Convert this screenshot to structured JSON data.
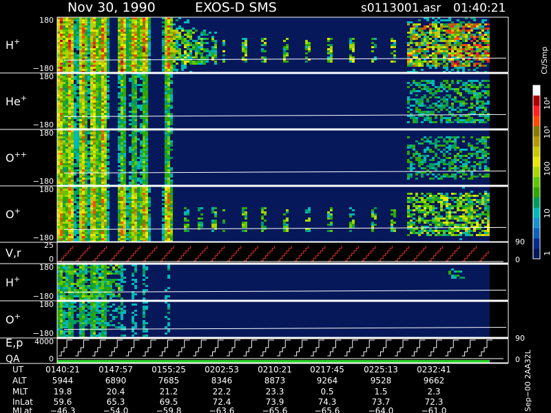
{
  "header": {
    "date": "Nov 30, 1990",
    "instrument": "EXOS-D SMS",
    "file": "s0113001.asr",
    "time": "01:40:21"
  },
  "colorbar": {
    "title": "Ct/Smp",
    "labels": [
      "10⁴",
      "10³",
      "100",
      "10",
      "1"
    ],
    "colors": [
      "#ffffff",
      "#b00000",
      "#ff2020",
      "#ff4a00",
      "#8b7a00",
      "#b49a00",
      "#c8c800",
      "#e8e800",
      "#a8d800",
      "#5ec800",
      "#2ea800",
      "#009a60",
      "#00b8b8",
      "#1890d0",
      "#1060b8",
      "#0a2a8a",
      "#06185a"
    ]
  },
  "panels": [
    {
      "label": "H",
      "sup": "+",
      "top_tick": "180",
      "bottom_tick": "−180"
    },
    {
      "label": "He",
      "sup": "+",
      "top_tick": "180",
      "bottom_tick": "−180"
    },
    {
      "label": "O",
      "sup": "++",
      "top_tick": "180",
      "bottom_tick": "−180"
    },
    {
      "label": "O",
      "sup": "+",
      "top_tick": "180",
      "bottom_tick": "−180"
    },
    {
      "label": "V,r",
      "sup": "",
      "top_tick": "25",
      "bottom_tick": "0",
      "right_top": "90",
      "right_bottom": "0"
    },
    {
      "label": "H",
      "sup": "+",
      "top_tick": "180",
      "bottom_tick": "−180"
    },
    {
      "label": "O",
      "sup": "+",
      "top_tick": "180",
      "bottom_tick": "−180"
    },
    {
      "label": "E,p",
      "label2": "QA",
      "sup": "",
      "top_tick": "4000",
      "bottom_tick": "0",
      "right_top": "90",
      "right_bottom": "0"
    }
  ],
  "footer": {
    "row_labels": [
      "UT",
      "ALT",
      "MLT",
      "InLat",
      "MLat"
    ],
    "columns": [
      [
        "0140:21",
        "5944",
        "19.8",
        "59.6",
        "−46.3"
      ],
      [
        "0147:57",
        "6890",
        "20.4",
        "65.3",
        "−54.0"
      ],
      [
        "0155:25",
        "7685",
        "21.2",
        "69.5",
        "−59.8"
      ],
      [
        "0202:53",
        "8346",
        "22.2",
        "72.4",
        "−63.6"
      ],
      [
        "0210:21",
        "8873",
        "23.3",
        "73.9",
        "−65.6"
      ],
      [
        "0217:45",
        "9264",
        "0.5",
        "74.3",
        "−65.6"
      ],
      [
        "0225:13",
        "9528",
        "1.5",
        "73.7",
        "−64.0"
      ],
      [
        "0232:41",
        "9662",
        "2.3",
        "72.3",
        "−61.0"
      ]
    ],
    "stamp": "Sep−00 2AA32L"
  },
  "chart_data": {
    "type": "heatmap",
    "title": "Nov 30, 1990  EXOS-D SMS  s0113001.asr 01:40:21",
    "x_ticks": [
      "0140:21",
      "0147:57",
      "0155:25",
      "0202:53",
      "0210:21",
      "0217:45",
      "0225:13",
      "0232:41"
    ],
    "y_range": [
      -180,
      180
    ],
    "color_scale": "log",
    "color_range": [
      1,
      10000
    ],
    "grid": false,
    "legend": "colorbar right"
  }
}
